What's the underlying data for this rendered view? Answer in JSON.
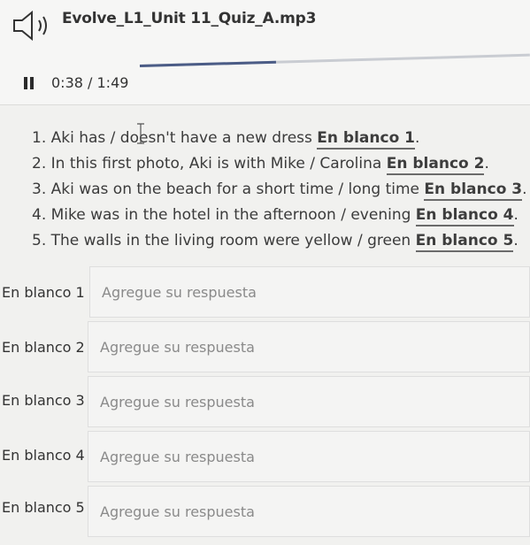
{
  "player": {
    "title": "Evolve_L1_Unit 11_Quiz_A.mp3",
    "time": "0:38 / 1:49",
    "progress": 0.35
  },
  "questions": [
    {
      "text": "1. Aki has / doesn't have a new dress ",
      "blank": "En blanco 1",
      "end": "."
    },
    {
      "text": "2. In this first photo, Aki is with Mike / Carolina ",
      "blank": "En blanco 2",
      "end": "."
    },
    {
      "text": "3. Aki was on the beach for a short time / long time ",
      "blank": "En blanco 3",
      "end": "."
    },
    {
      "text": "4. Mike was in the hotel in the afternoon / evening ",
      "blank": "En blanco 4",
      "end": "."
    },
    {
      "text": "5. The walls in the living room were yellow / green ",
      "blank": "En blanco 5",
      "end": "."
    }
  ],
  "answers": [
    {
      "label": "En blanco 1",
      "placeholder": "Agregue su respuesta"
    },
    {
      "label": "En blanco 2",
      "placeholder": "Agregue su respuesta"
    },
    {
      "label": "En blanco 3",
      "placeholder": "Agregue su respuesta"
    },
    {
      "label": "En blanco 4",
      "placeholder": "Agregue su respuesta"
    },
    {
      "label": "En blanco 5",
      "placeholder": "Agregue su respuesta"
    }
  ]
}
